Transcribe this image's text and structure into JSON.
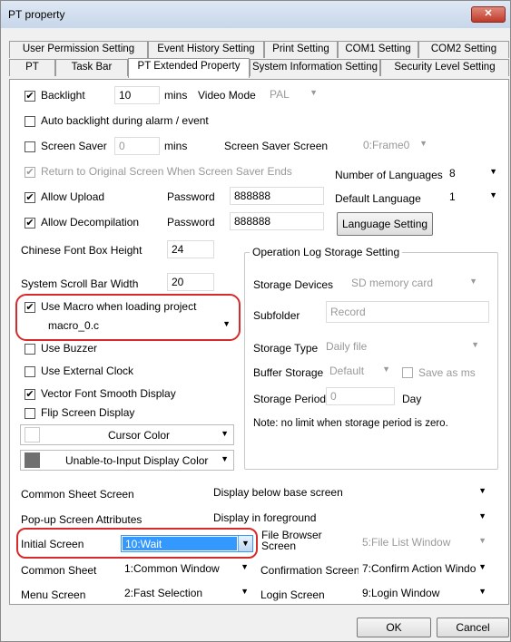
{
  "window": {
    "title": "PT property",
    "close_label": "✕"
  },
  "tabs_row1": [
    "User Permission Setting",
    "Event History Setting",
    "Print Setting",
    "COM1 Setting",
    "COM2 Setting"
  ],
  "tabs_row2": [
    "PT",
    "Task Bar",
    "PT Extended Property",
    "System Information Setting",
    "Security Level Setting"
  ],
  "backlight": {
    "label": "Backlight",
    "value": "10",
    "unit": "mins",
    "checked": "✔"
  },
  "video_mode": {
    "label": "Video Mode",
    "value": "PAL"
  },
  "auto_backlight": {
    "label": "Auto backlight during alarm / event"
  },
  "screen_saver": {
    "label": "Screen Saver",
    "value": "0",
    "unit": "mins",
    "screen_label": "Screen Saver Screen",
    "screen_value": "0:Frame0"
  },
  "return_original": {
    "label": "Return to Original Screen When Screen Saver Ends",
    "checked": "✔"
  },
  "languages": {
    "num_label": "Number of Languages",
    "num_value": "8",
    "default_label": "Default Language",
    "default_value": "1",
    "button": "Language Setting"
  },
  "allow_upload": {
    "label": "Allow Upload",
    "checked": "✔",
    "password_label": "Password",
    "password": "888888"
  },
  "allow_decompile": {
    "label": "Allow Decompilation",
    "checked": "✔",
    "password_label": "Password",
    "password": "888888"
  },
  "font_box": {
    "label": "Chinese Font Box Height",
    "value": "24"
  },
  "scroll_bar": {
    "label": "System Scroll Bar Width",
    "value": "20"
  },
  "macro": {
    "label": "Use Macro when loading project",
    "checked": "✔",
    "value": "macro_0.c"
  },
  "use_buzzer": {
    "label": "Use Buzzer"
  },
  "ext_clock": {
    "label": "Use External Clock"
  },
  "vector_font": {
    "label": "Vector Font Smooth Display",
    "checked": "✔"
  },
  "flip_screen": {
    "label": "Flip Screen Display"
  },
  "cursor_color": {
    "label": "Cursor Color",
    "swatch": "#ffffff"
  },
  "unable_color": {
    "label": "Unable-to-Input Display Color",
    "swatch": "#707070"
  },
  "oplog": {
    "title": "Operation Log Storage Setting",
    "storage_label": "Storage Devices",
    "storage_value": "SD memory card",
    "subfolder_label": "Subfolder",
    "subfolder_value": "Record",
    "type_label": "Storage Type",
    "type_value": "Daily file",
    "buffer_label": "Buffer Storage",
    "buffer_value": "Default",
    "save_as_ms": "Save as ms",
    "period_label": "Storage Period",
    "period_value": "0",
    "period_unit": "Day",
    "note": "Note: no limit when storage period is zero."
  },
  "common_sheet_screen": {
    "label": "Common Sheet Screen",
    "value": "Display below base screen"
  },
  "popup_attr": {
    "label": "Pop-up Screen Attributes",
    "value": "Display in foreground"
  },
  "initial_screen": {
    "label": "Initial Screen",
    "value": "10:Wait"
  },
  "file_browser": {
    "label_line1": "File Browser",
    "label_line2": "Screen",
    "value": "5:File List Window"
  },
  "common_sheet": {
    "label": "Common Sheet",
    "value": "1:Common Window"
  },
  "confirm_screen": {
    "label": "Confirmation Screen",
    "value": "7:Confirm Action Windo"
  },
  "menu_screen": {
    "label": "Menu Screen",
    "value": "2:Fast Selection"
  },
  "login_screen": {
    "label": "Login Screen",
    "value": "9:Login Window"
  },
  "buttons": {
    "ok": "OK",
    "cancel": "Cancel"
  },
  "icons": {
    "dropdown": "▼"
  },
  "colors": {
    "highlight": "#d62b2b",
    "selection": "#3399ff"
  }
}
